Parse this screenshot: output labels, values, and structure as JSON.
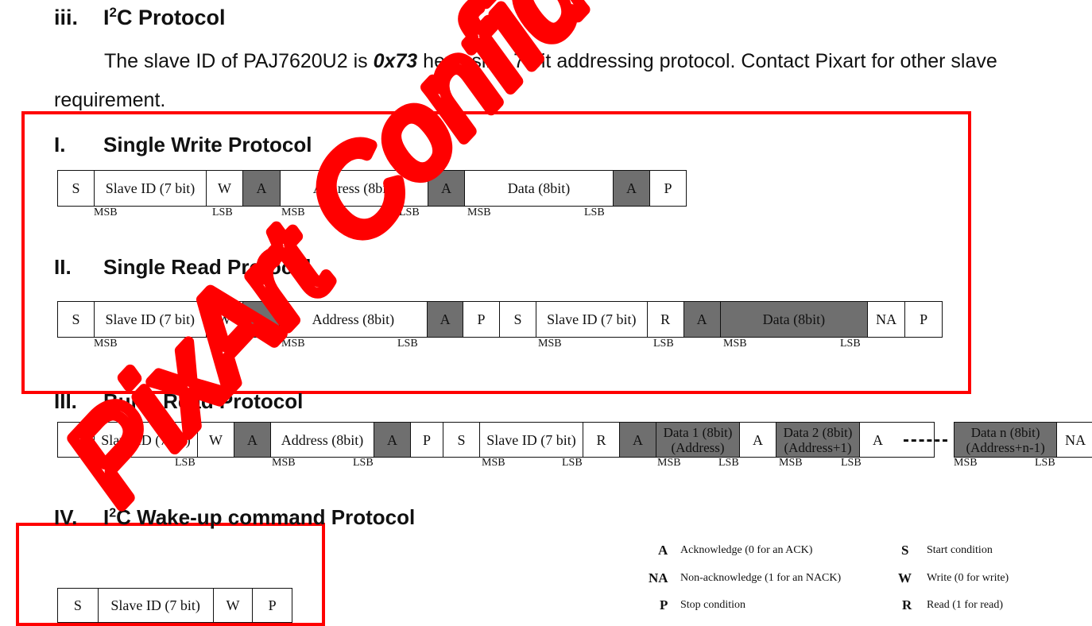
{
  "heading": {
    "num": "iii.",
    "pre": "I",
    "sup": "2",
    "post": "C Protocol"
  },
  "intro": {
    "t1": "The slave ID of PAJ7620U2 is ",
    "hex": "0x73",
    "t2": " hex using 7 bit addressing protocol. Contact Pixart for other slave",
    "line2": "requirement."
  },
  "sections": {
    "write": {
      "num": "I.",
      "title": "Single Write Protocol"
    },
    "read": {
      "num": "II.",
      "title": "Single Read Protocol"
    },
    "burst": {
      "num": "III.",
      "title": "Burst Read Protocol"
    },
    "wake": {
      "num": "IV.",
      "pre": "I",
      "sup": "2",
      "post": "C Wake-up command Protocol"
    }
  },
  "write_row": [
    "S",
    "Slave ID (7 bit)",
    "W",
    "A",
    "Address (8bit)",
    "A",
    "Data (8bit)",
    "A",
    "P"
  ],
  "write_ticks": [
    "MSB",
    "LSB",
    "MSB",
    "LSB",
    "MSB",
    "LSB"
  ],
  "read_row": [
    "S",
    "Slave ID (7 bit)",
    "W",
    "A",
    "Address (8bit)",
    "A",
    "P",
    "S",
    "Slave ID (7 bit)",
    "R",
    "A",
    "Data (8bit)",
    "NA",
    "P"
  ],
  "read_ticks": [
    "MSB",
    "LSB",
    "MSB",
    "LSB",
    "MSB",
    "LSB",
    "MSB",
    "LSB"
  ],
  "burst_row": [
    "S",
    "Slave ID (7 bit)",
    "W",
    "A",
    "Address (8bit)",
    "A",
    "P",
    "S",
    "Slave ID (7 bit)",
    "R",
    "A",
    "Data 1 (8bit)",
    "(Address)",
    "A",
    "Data 2 (8bit)",
    "(Address+1)",
    "A",
    "Data n (8bit)",
    "(Address+n-1)",
    "NA"
  ],
  "burst_ticks": [
    "MSB",
    "LSB",
    "MSB",
    "LSB",
    "MSB",
    "LSB",
    "MSB",
    "LSB",
    "MSB",
    "LSB",
    "MSB",
    "LSB"
  ],
  "wake_row": [
    "S",
    "Slave ID (7 bit)",
    "W",
    "P"
  ],
  "legend": [
    {
      "sym": "A",
      "text": "Acknowledge (0 for an ACK)"
    },
    {
      "sym": "S",
      "text": "Start condition"
    },
    {
      "sym": "NA",
      "text": "Non-acknowledge (1 for an NACK)"
    },
    {
      "sym": "W",
      "text": "Write (0 for write)"
    },
    {
      "sym": "P",
      "text": "Stop condition"
    },
    {
      "sym": "R",
      "text": "Read (1 for read)"
    }
  ],
  "watermark": "PixArt Confidential",
  "colors": {
    "highlight": "#ff0000",
    "ack_fill": "#6f6f6f",
    "watermark": "#ff0000"
  }
}
